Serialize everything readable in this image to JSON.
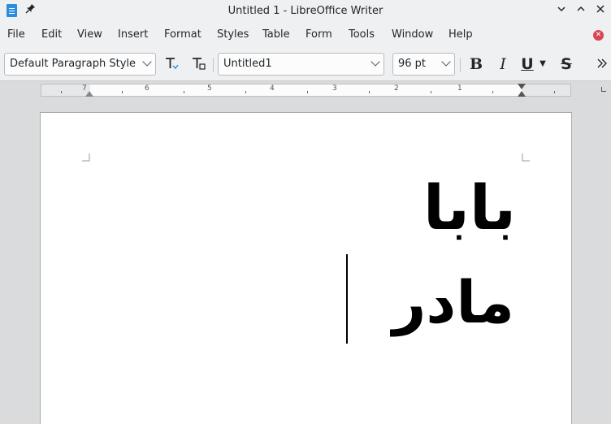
{
  "window": {
    "title": "Untitled 1 - LibreOffice Writer"
  },
  "menu": [
    "File",
    "Edit",
    "View",
    "Insert",
    "Format",
    "Styles",
    "Table",
    "Form",
    "Tools",
    "Window",
    "Help"
  ],
  "toolbar": {
    "paragraph_style": "Default Paragraph Style",
    "font_name": "Untitled1",
    "font_size": "96 pt",
    "bold_glyph": "B",
    "italic_glyph": "I",
    "underline_glyph": "U",
    "strike_glyph": "S"
  },
  "ruler": {
    "numbers": [
      "7",
      "6",
      "5",
      "4",
      "3",
      "2",
      "1"
    ]
  },
  "document": {
    "lines": [
      "بابا",
      "مادر"
    ]
  },
  "colors": {
    "accent": "#2a8ee0",
    "close_doc": "#da4453"
  },
  "icons": {
    "app": "writer-document-icon",
    "pin": "pin-icon",
    "minimize": "chevron-down-icon",
    "maximize": "chevron-up-icon",
    "close": "close-icon"
  }
}
